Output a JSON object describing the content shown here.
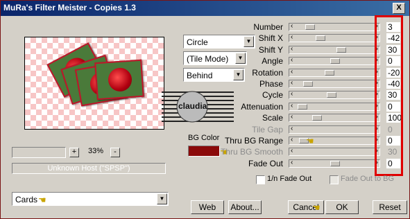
{
  "window": {
    "title": "MuRa's Filter Meister - Copies 1.3",
    "close_glyph": "X"
  },
  "preview": {
    "zoom_value": "33%",
    "zoom_plus": "+",
    "zoom_minus": "-",
    "status_text": "Unknown Host (\"SPSP\")"
  },
  "dropdowns": {
    "shape": "Circle",
    "tile_mode": "(Tile Mode)",
    "layer_mode": "Behind",
    "preset": "Cards"
  },
  "logo_text": "claudia",
  "bg_color": {
    "label": "BG Color",
    "value": "#8b0a0a"
  },
  "params": [
    {
      "label": "Number",
      "value": "3",
      "level": 0.12,
      "enabled": true
    },
    {
      "label": "Shift X",
      "value": "-42",
      "level": 0.28,
      "enabled": true
    },
    {
      "label": "Shift Y",
      "value": "30",
      "level": 0.6,
      "enabled": true
    },
    {
      "label": "Angle",
      "value": "0",
      "level": 0.5,
      "enabled": true
    },
    {
      "label": "Rotation",
      "value": "-20",
      "level": 0.42,
      "enabled": true
    },
    {
      "label": "Phase",
      "value": "-40",
      "level": 0.08,
      "enabled": true
    },
    {
      "label": "Cycle",
      "value": "30",
      "level": 0.45,
      "enabled": true
    },
    {
      "label": "Attenuation",
      "value": "0",
      "level": 0.0,
      "enabled": true
    },
    {
      "label": "Scale",
      "value": "100",
      "level": 0.22,
      "enabled": true
    },
    {
      "label": "Tile Gap",
      "value": "0",
      "level": 0.0,
      "enabled": false
    },
    {
      "label": "Thru BG Range",
      "value": "0",
      "level": 0.02,
      "enabled": true
    },
    {
      "label": "Thru BG Smooth",
      "value": "30",
      "level": 0.0,
      "enabled": false
    },
    {
      "label": "Fade Out",
      "value": "0",
      "level": 0.5,
      "enabled": true
    }
  ],
  "checkboxes": {
    "reverse_fade": "1/n Fade Out",
    "fade_to_bg": "Fade Out to BG"
  },
  "buttons": {
    "web": "Web",
    "about": "About...",
    "cancel": "Cancel",
    "ok": "OK",
    "reset": "Reset"
  },
  "colors": {
    "highlight_border": "#e00000",
    "title_bar": "#0a246a",
    "hand_pointer": "#c9a400"
  }
}
